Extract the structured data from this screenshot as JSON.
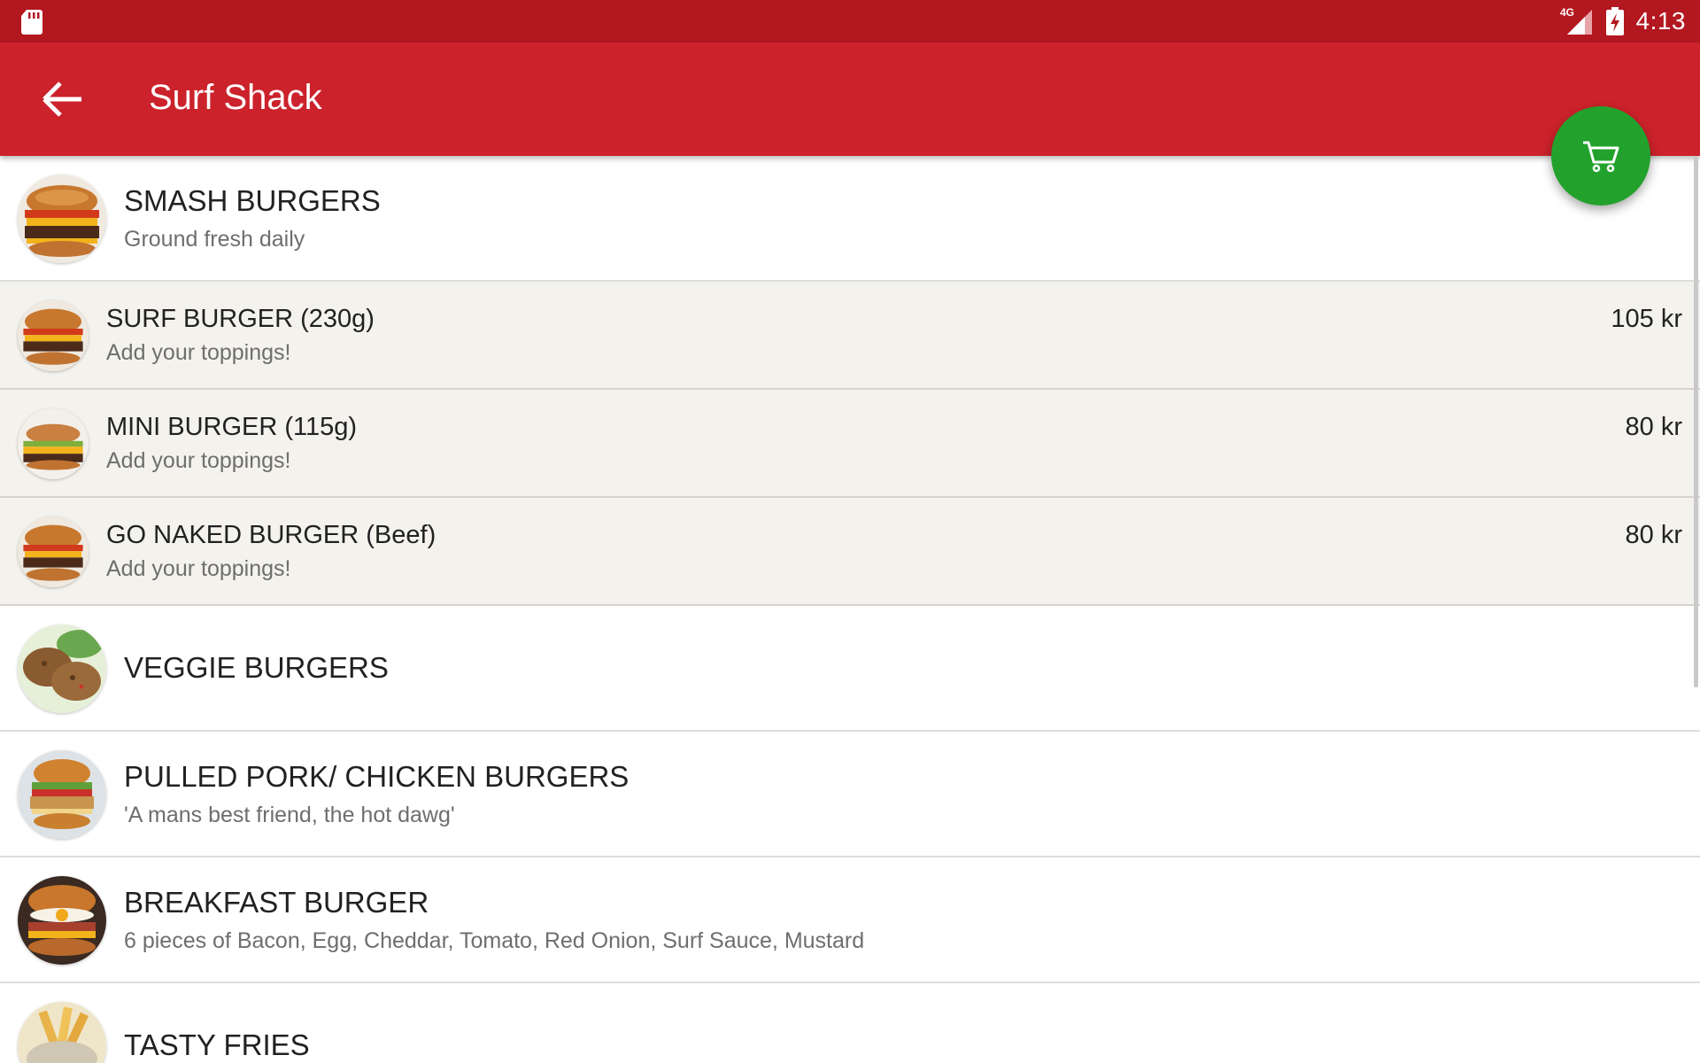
{
  "status_bar": {
    "network": "4G",
    "time": "4:13",
    "icons": [
      "sd-card-icon",
      "signal-icon",
      "battery-charging-icon"
    ]
  },
  "toolbar": {
    "back_icon": "arrow-left-icon",
    "title": "Surf Shack"
  },
  "cart_button": {
    "icon": "cart-icon"
  },
  "colors": {
    "status_bar": "#b31720",
    "app_bar": "#cc222b",
    "fab": "#22a22d",
    "item_row_bg": "#f4f2ec"
  },
  "categories": [
    {
      "title": "SMASH BURGERS",
      "subtitle": "Ground fresh daily",
      "items": [
        {
          "name": "SURF BURGER (230g)",
          "description": "Add your toppings!",
          "price": "105 kr"
        },
        {
          "name": "MINI BURGER (115g)",
          "description": "Add your toppings!",
          "price": "80 kr"
        },
        {
          "name": "GO NAKED BURGER (Beef)",
          "description": "Add your toppings!",
          "price": "80 kr"
        }
      ]
    },
    {
      "title": "VEGGIE BURGERS",
      "subtitle": ""
    },
    {
      "title": "PULLED PORK/ CHICKEN BURGERS",
      "subtitle": "'A mans best friend, the hot dawg'"
    },
    {
      "title": "BREAKFAST BURGER",
      "subtitle": "6 pieces of Bacon, Egg, Cheddar, Tomato, Red Onion, Surf Sauce, Mustard"
    },
    {
      "title": "TASTY FRIES",
      "subtitle": ""
    }
  ]
}
